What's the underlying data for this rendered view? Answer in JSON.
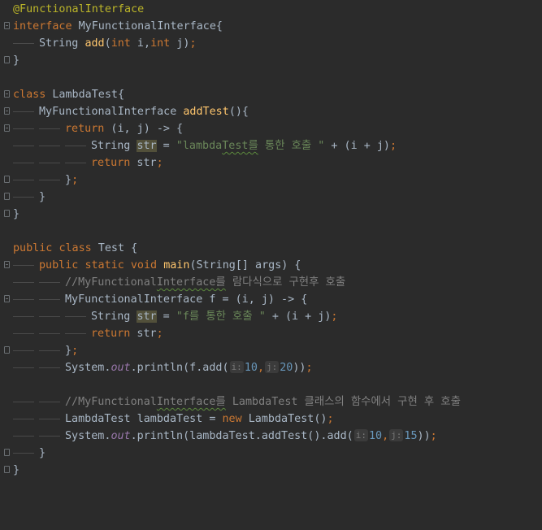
{
  "editor": {
    "l1": {
      "t1": "@FunctionalInterface"
    },
    "l2": {
      "t1": "interface",
      "t2": " MyFunctionalInterface{"
    },
    "l3": {
      "t1": "String ",
      "t2": "add",
      "t3": "(",
      "t4": "int",
      "t5": " i,",
      "t6": "int",
      "t7": " j)",
      "t8": ";"
    },
    "l4": {
      "t1": "}"
    },
    "l6": {
      "t1": "class",
      "t2": " LambdaTest{"
    },
    "l7": {
      "t1": "MyFunctionalInterface ",
      "t2": "addTest",
      "t3": "(){"
    },
    "l8": {
      "t1": "return",
      "t2": " (i, j) -> {"
    },
    "l9": {
      "t1": "String ",
      "t2": "str",
      "t3": " = ",
      "t4": "\"lambda",
      "t5": "Test를",
      "t6": " 통한 호출 \"",
      "t7": " + (i + j)",
      "t8": ";"
    },
    "l10": {
      "t1": "return",
      "t2": " str",
      "t3": ";"
    },
    "l11": {
      "t1": "}",
      "t2": ";"
    },
    "l12": {
      "t1": "}"
    },
    "l13": {
      "t1": "}"
    },
    "l15": {
      "t1": "public",
      "t2": " ",
      "t3": "class",
      "t4": " Test {"
    },
    "l16": {
      "t1": "public",
      "t2": " ",
      "t3": "static",
      "t4": " ",
      "t5": "void",
      "t6": " ",
      "t7": "main",
      "t8": "(String[] args) {"
    },
    "l17": {
      "t1": "//MyFunctional",
      "t2": "Interface를",
      "t3": " 람다식으로 구현후 호출"
    },
    "l18": {
      "t1": "MyFunctionalInterface f = (i, j) -> {"
    },
    "l19": {
      "t1": "String ",
      "t2": "str",
      "t3": " = ",
      "t4": "\"f를 통한 호출 \"",
      "t5": " + (i + j)",
      "t6": ";"
    },
    "l20": {
      "t1": "return",
      "t2": " str",
      "t3": ";"
    },
    "l21": {
      "t1": "}",
      "t2": ";"
    },
    "l22": {
      "t1": "System.",
      "t2": "out",
      "t3": ".println(f.add(",
      "h1": "i:",
      "t4": "10",
      "t5": ",",
      "h2": "j:",
      "t6": "20",
      "t7": "))",
      "t8": ";"
    },
    "l24": {
      "t1": "//MyFunctional",
      "t2": "Interface를",
      "t3": " LambdaTest 클래스의 함수에서 구현 후 호출"
    },
    "l25": {
      "t1": "LambdaTest lambdaTest = ",
      "t2": "new",
      "t3": " LambdaTest()",
      "t4": ";"
    },
    "l26": {
      "t1": "System.",
      "t2": "out",
      "t3": ".println(lambdaTest.addTest().add(",
      "h1": "i:",
      "t4": "10",
      "t5": ",",
      "h2": "j:",
      "t6": "15",
      "t7": "))",
      "t8": ";"
    },
    "l27": {
      "t1": "}"
    },
    "l28": {
      "t1": "}"
    }
  }
}
